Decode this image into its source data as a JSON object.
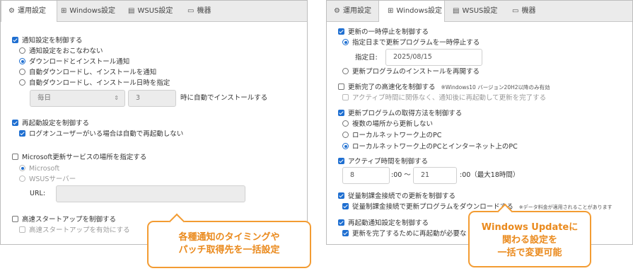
{
  "left_panel": {
    "tabs": [
      {
        "icon": "gear-icon",
        "glyph": "⚙",
        "label": "運用設定"
      },
      {
        "icon": "windows-icon",
        "glyph": "⊞",
        "label": "Windows設定"
      },
      {
        "icon": "server-icon",
        "glyph": "▤",
        "label": "WSUS設定"
      },
      {
        "icon": "monitor-icon",
        "glyph": "▭",
        "label": "機器"
      }
    ],
    "notify": {
      "label": "通知設定を制御する",
      "options": [
        "通知設定をおこなわない",
        "ダウンロードとインストール通知",
        "自動ダウンロードし、インストールを通知",
        "自動ダウンロードし、インストール日時を指定"
      ],
      "day_value": "毎日",
      "hour_value": "3",
      "suffix": "時に自動でインストールする"
    },
    "restart": {
      "label": "再起動設定を制御する",
      "sub": "ログオンユーザーがいる場合は自動で再起動しない"
    },
    "msupdate": {
      "label": "Microsoft更新サービスの場所を指定する",
      "options": [
        "Microsoft",
        "WSUSサーバー"
      ],
      "url_label": "URL:"
    },
    "fast": {
      "label": "高速スタートアップを制御する",
      "sub": "高速スタートアップを有効にする"
    }
  },
  "right_panel": {
    "tabs": [
      {
        "icon": "gear-icon",
        "glyph": "⚙",
        "label": "運用設定"
      },
      {
        "icon": "windows-icon",
        "glyph": "⊞",
        "label": "Windows設定"
      },
      {
        "icon": "server-icon",
        "glyph": "▤",
        "label": "WSUS設定"
      },
      {
        "icon": "monitor-icon",
        "glyph": "▭",
        "label": "機器"
      }
    ],
    "pause": {
      "label": "更新の一時停止を制御する",
      "option1": "指定日まで更新プログラムを一時停止する",
      "date_label": "指定日:",
      "date_value": "2025/08/15",
      "option2": "更新プログラムのインストールを再開する"
    },
    "fastcomplete": {
      "label": "更新完了の高速化を制御する",
      "note": "※Windows10 バージョン20H2以降のみ有効",
      "sub": "アクティブ時間に関係なく、通知後に再起動して更新を完了する"
    },
    "source": {
      "label": "更新プログラムの取得方法を制御する",
      "options": [
        "複数の場所から更新しない",
        "ローカルネットワーク上のPC",
        "ローカルネットワーク上のPCとインターネット上のPC"
      ]
    },
    "active": {
      "label": "アクティブ時間を制御する",
      "start": "8",
      "sep": ":00 〜",
      "end": "21",
      "suffix": ":00（最大18時間）"
    },
    "metered": {
      "label": "従量制課金接続での更新を制御する",
      "sub": "従量制課金接続で更新プログラムをダウンロードする",
      "note": "※データ料金が適用されることがあります"
    },
    "restartnotify": {
      "label": "再起動通知設定を制御する",
      "sub": "更新を完了するために再起動が必要な"
    }
  },
  "callouts": {
    "left": [
      "各種通知のタイミングや",
      "パッチ取得先を一括設定"
    ],
    "right": [
      "Windows Updateに",
      "関わる設定を",
      "一括で変更可能"
    ]
  },
  "colors": {
    "accent": "#1f6fd1",
    "callout": "#f39c33"
  }
}
